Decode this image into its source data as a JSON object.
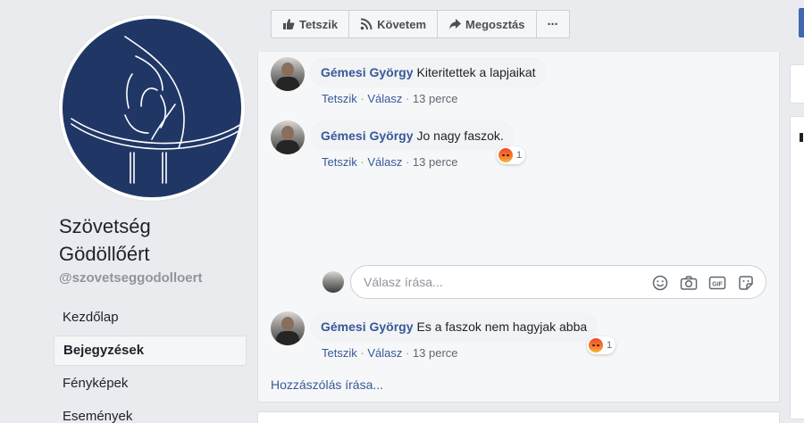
{
  "page": {
    "name": "Szövetség Gödöllőért",
    "name_line1": "Szövetség",
    "name_line2": "Gödöllőért",
    "handle": "@szovetseggodolloert"
  },
  "nav": {
    "items": [
      {
        "label": "Kezdőlap",
        "active": false
      },
      {
        "label": "Bejegyzések",
        "active": true
      },
      {
        "label": "Fényképek",
        "active": false
      },
      {
        "label": "Események",
        "active": false
      }
    ]
  },
  "actions": {
    "like": "Tetszik",
    "follow": "Követem",
    "share": "Megosztás",
    "more": "···"
  },
  "comments": [
    {
      "author": "Gémesi György",
      "text": "Kiteritettek a lapjaikat",
      "like": "Tetszik",
      "reply": "Válasz",
      "time": "13 perce",
      "reactions": null
    },
    {
      "author": "Gémesi György",
      "text": "Jo nagy faszok.",
      "like": "Tetszik",
      "reply": "Válasz",
      "time": "13 perce",
      "reactions": {
        "icon": "angry-reaction-icon",
        "count": "1"
      }
    },
    {
      "author": "Gémesi György",
      "text": "Es a faszok nem hagyjak abba",
      "like": "Tetszik",
      "reply": "Válasz",
      "time": "13 perce",
      "reactions": {
        "icon": "angry-reaction-icon",
        "count": "1"
      }
    }
  ],
  "reply_box": {
    "placeholder": "Válasz írása...",
    "icons": [
      "emoji-icon",
      "camera-icon",
      "gif-icon",
      "sticker-icon"
    ]
  },
  "write_comment": "Hozzászólás írása...",
  "colors": {
    "brand": "#4267b2",
    "link": "#385898",
    "logo_background": "#203766"
  }
}
